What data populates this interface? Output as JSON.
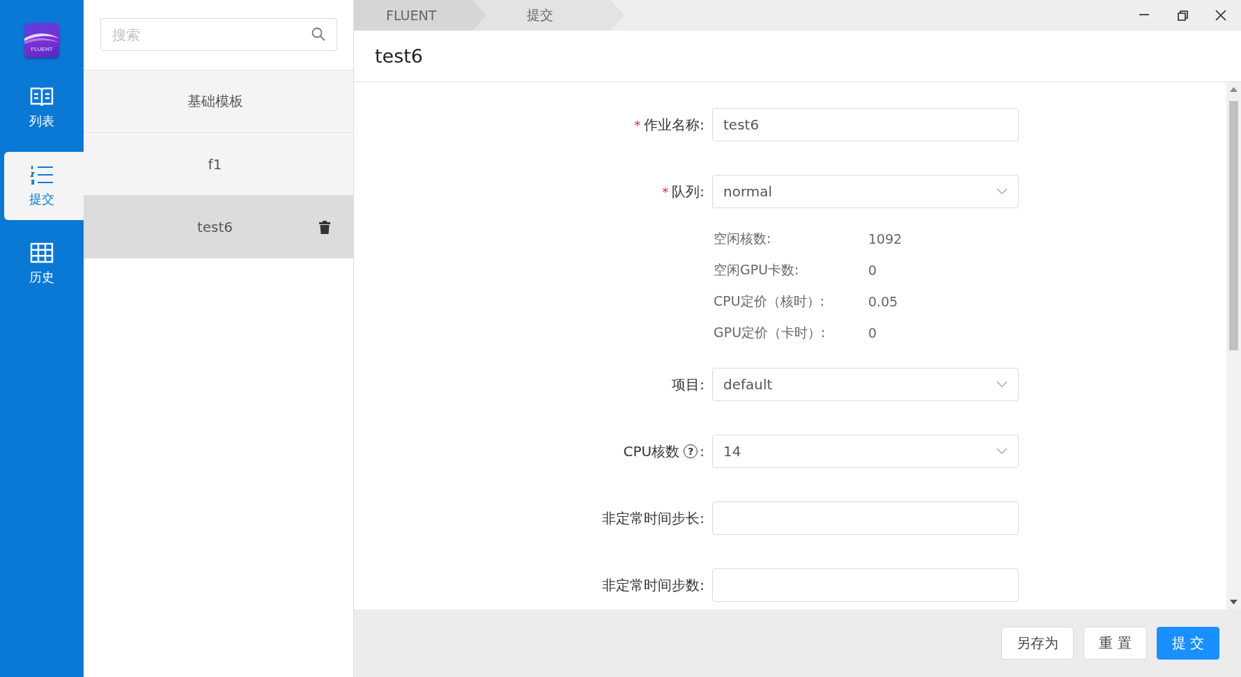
{
  "logo": {
    "text": "FLUENT"
  },
  "nav": [
    {
      "label": "列表",
      "kind": "book",
      "selected": false
    },
    {
      "label": "提交",
      "kind": "list",
      "selected": true
    },
    {
      "label": "历史",
      "kind": "grid",
      "selected": false
    }
  ],
  "search": {
    "placeholder": "搜索"
  },
  "templates": [
    {
      "label": "基础模板",
      "selected": false,
      "deletable": false
    },
    {
      "label": "f1",
      "selected": false,
      "deletable": false
    },
    {
      "label": "test6",
      "selected": true,
      "deletable": true
    }
  ],
  "breadcrumb": [
    "FLUENT",
    "提交"
  ],
  "title": "test6",
  "form": [
    {
      "kind": "input",
      "required_mark": "*",
      "label": "作业名称",
      "colon": ":",
      "value": "test6"
    },
    {
      "kind": "select",
      "required_mark": "*",
      "label": "队列",
      "colon": ":",
      "value": "normal"
    },
    {
      "kind": "info",
      "rows": [
        {
          "label": "空闲核数:",
          "value": "1092"
        },
        {
          "label": "空闲GPU卡数:",
          "value": "0"
        },
        {
          "label": "CPU定价（核时）:",
          "value": "0.05"
        },
        {
          "label": "GPU定价（卡时）:",
          "value": "0"
        }
      ]
    },
    {
      "kind": "select",
      "label": "项目",
      "colon": ":",
      "value": "default"
    },
    {
      "kind": "select",
      "label": "CPU核数",
      "help": "?",
      "colon": ":",
      "value": "14"
    },
    {
      "kind": "input",
      "label": "非定常时间步长",
      "colon": ":"
    },
    {
      "kind": "input",
      "label": "非定常时间步数",
      "colon": ":"
    }
  ],
  "buttons": [
    {
      "label": "另存为",
      "kind": "default"
    },
    {
      "label": "重 置",
      "kind": "default"
    },
    {
      "label": "提 交",
      "kind": "primary"
    }
  ]
}
